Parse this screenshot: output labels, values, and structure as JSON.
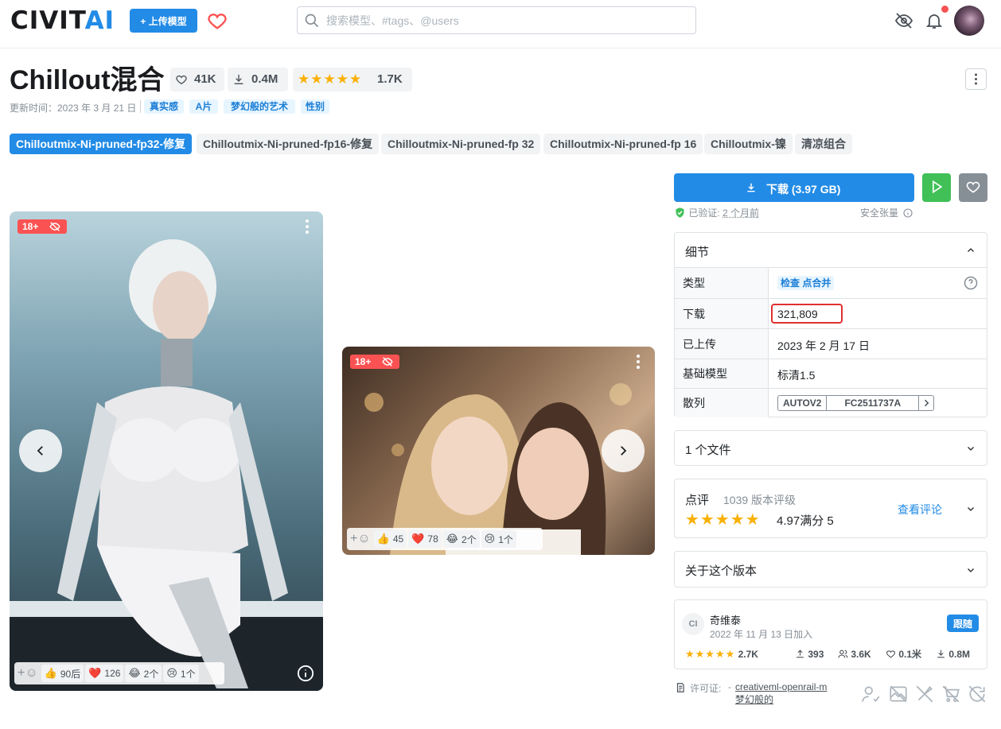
{
  "header": {
    "logo_main": "CIVIT",
    "logo_ai": "AI",
    "upload_label": "+ 上传模型",
    "search_placeholder": "搜索模型、#tags、@users"
  },
  "model": {
    "title": "Chillout混合",
    "likes": "41K",
    "downloads": "0.4M",
    "rating": "1.7K",
    "updated": "更新时间：2023 年 3 月 21 日",
    "tags": [
      "真实感",
      "A片",
      "梦幻般的艺术",
      "性别"
    ]
  },
  "versions": [
    "Chilloutmix-Ni-pruned-fp32-修复",
    "Chilloutmix-Ni-pruned-fp16-修复",
    "Chilloutmix-Ni-pruned-fp 32",
    "Chilloutmix-Ni-pruned-fp 16",
    "Chilloutmix-镍",
    "清凉组合"
  ],
  "images": [
    {
      "badge": "18+",
      "reactions": [
        {
          "emoji": "👍",
          "count": "90后"
        },
        {
          "emoji": "❤️",
          "count": "126"
        },
        {
          "emoji": "😂",
          "count": "2个"
        },
        {
          "emoji": "😢",
          "count": "1个"
        }
      ]
    },
    {
      "badge": "18+",
      "reactions": [
        {
          "emoji": "👍",
          "count": "45"
        },
        {
          "emoji": "❤️",
          "count": "78"
        },
        {
          "emoji": "😂",
          "count": "2个"
        },
        {
          "emoji": "😢",
          "count": "1个"
        }
      ]
    }
  ],
  "download": {
    "label": "下载 (3.97 GB)",
    "verified_label": "已验证:",
    "verified_time": "2 个月前",
    "safe_label": "安全张量"
  },
  "details": {
    "heading": "细节",
    "rows": {
      "type_label": "类型",
      "type_value": "检查 点合并",
      "downloads_label": "下载",
      "downloads_value": "321,809",
      "uploaded_label": "已上传",
      "uploaded_value": "2023 年 2 月 17 日",
      "base_label": "基础模型",
      "base_value": "标清1.5",
      "hash_label": "散列",
      "hash_type": "AUTOV2",
      "hash_value": "FC2511737A"
    }
  },
  "files_heading": "1 个文件",
  "reviews": {
    "heading": "点评",
    "count_label": "1039 版本评级",
    "score": "4.97满分 5",
    "link": "查看评论"
  },
  "about_heading": "关于这个版本",
  "creator": {
    "initials": "CI",
    "name": "奇维泰",
    "joined": "2022 年 11 月 13 日加入",
    "follow": "跟随",
    "rating": "2.7K",
    "uploads": "393",
    "followers": "3.6K",
    "likes": "0.1米",
    "downloads": "0.8M"
  },
  "license": {
    "label": "许可证:",
    "name": "creativeml-openrail-m",
    "sub": "梦幻般的"
  },
  "colors": {
    "accent": "#228be6",
    "nsfw": "#fa5252",
    "star": "#fab005",
    "play": "#40c057",
    "highlight_box": "#e03131"
  }
}
